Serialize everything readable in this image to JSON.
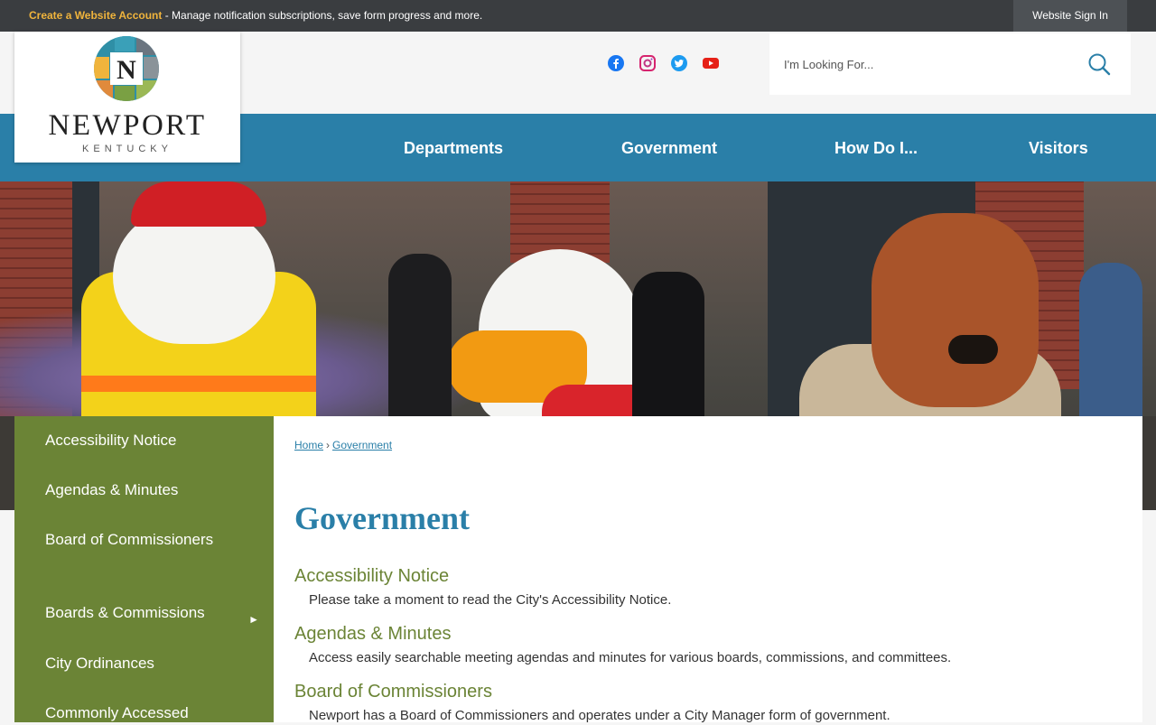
{
  "topbar": {
    "create_label": "Create a Website Account",
    "create_suffix": " - Manage notification subscriptions, save form progress and more.",
    "signin_label": "Website Sign In"
  },
  "logo": {
    "letter": "N",
    "name": "NEWPORT",
    "state": "KENTUCKY"
  },
  "social": [
    "facebook-icon",
    "instagram-icon",
    "twitter-icon",
    "youtube-icon"
  ],
  "search": {
    "placeholder": "I'm Looking For..."
  },
  "nav": {
    "items": [
      "Departments",
      "Government",
      "How Do I...",
      "Visitors"
    ]
  },
  "sidebar": {
    "items": [
      "Accessibility Notice",
      "Agendas & Minutes",
      "Board of Commissioners",
      "Boards & Commissions",
      "City Ordinances",
      "Commonly Accessed"
    ],
    "submenu_arrow": "►"
  },
  "breadcrumb": {
    "home": "Home",
    "separator": "›",
    "current": "Government"
  },
  "page": {
    "title": "Government",
    "entries": [
      {
        "heading": "Accessibility Notice",
        "text": "Please take a moment to read the City's Accessibility Notice."
      },
      {
        "heading": "Agendas & Minutes",
        "text": "Access easily searchable meeting agendas and minutes for various boards, commissions, and committees."
      },
      {
        "heading": "Board of Commissioners",
        "text": "Newport has a Board of Commissioners and operates under a City Manager form of government."
      }
    ]
  },
  "colors": {
    "nav_blue": "#2a7fa8",
    "sidebar_green": "#6b8436",
    "topbar_dark": "#3a3d40",
    "accent_gold": "#f0b43c"
  }
}
